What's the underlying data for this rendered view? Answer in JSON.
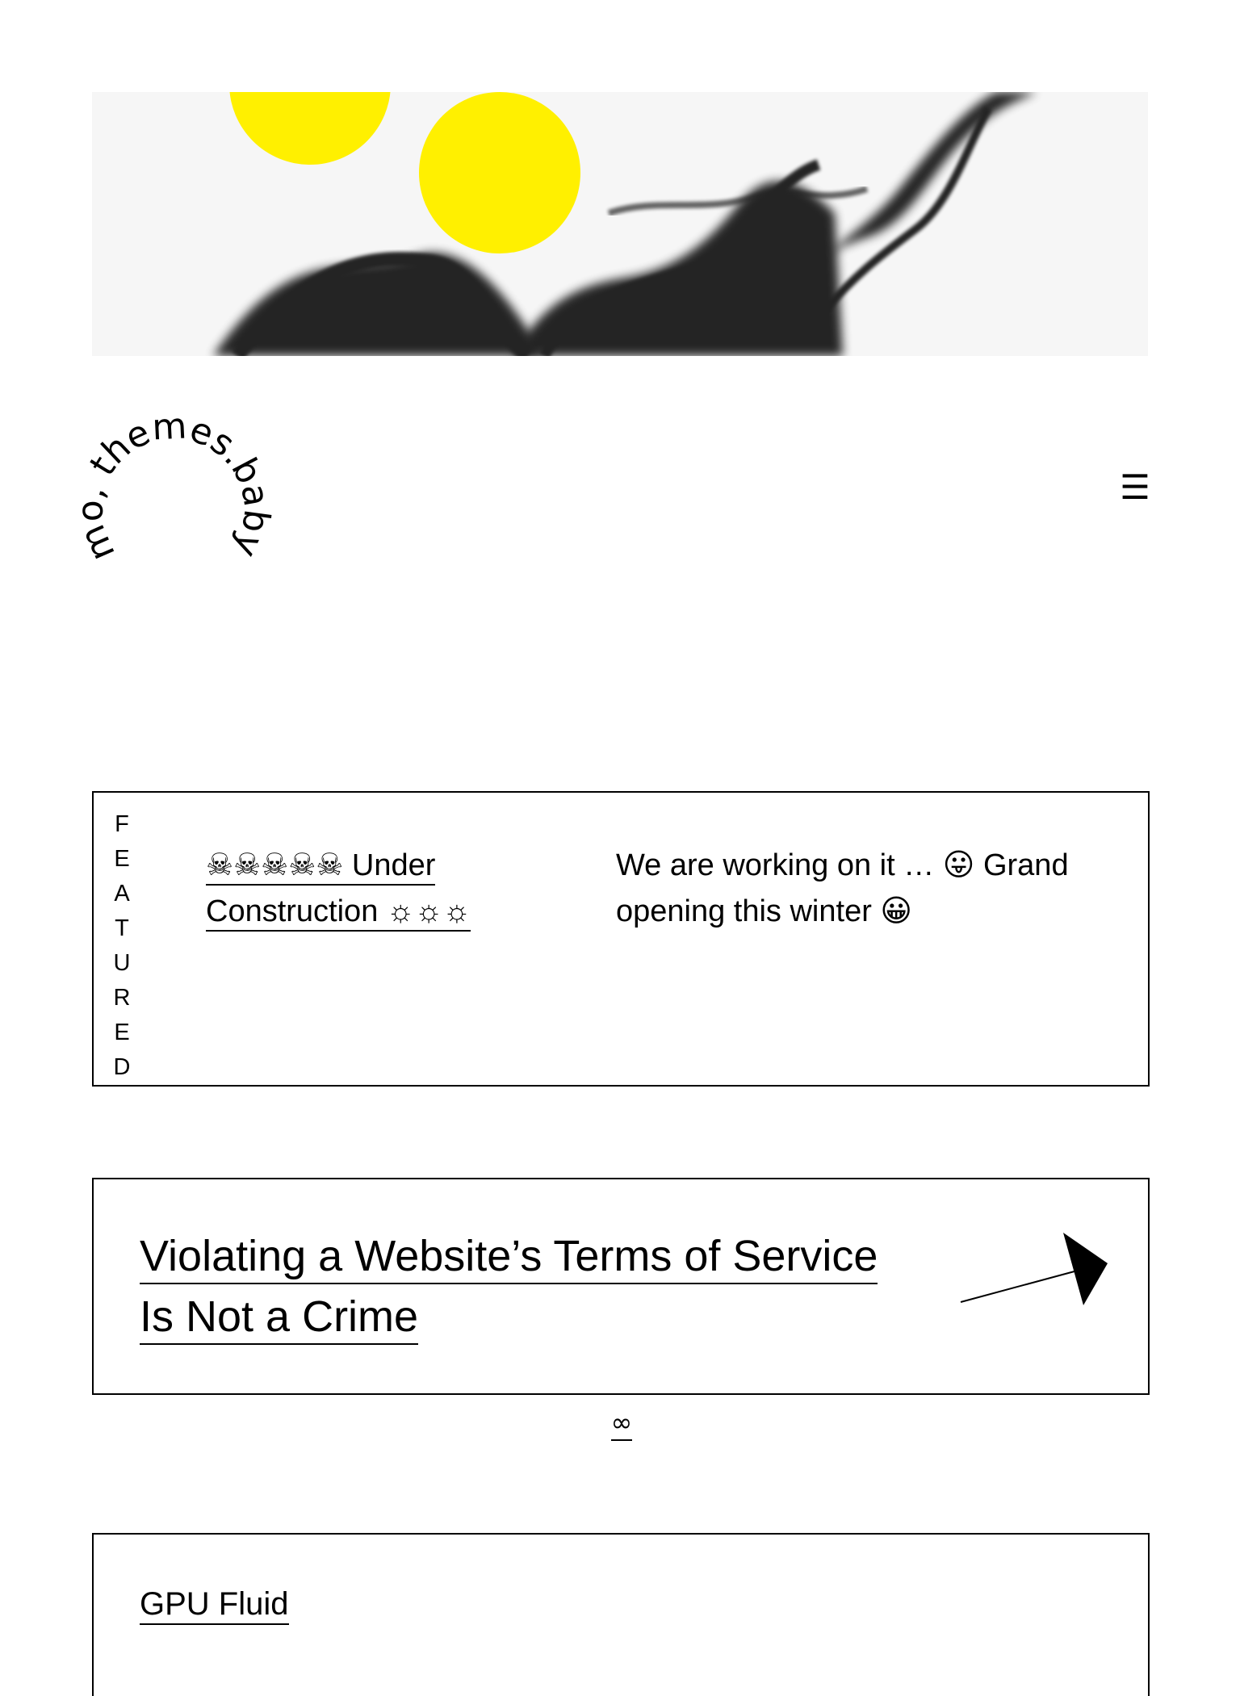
{
  "colors": {
    "accent": "#fff000",
    "ink": "#000000",
    "background": "#ffffff"
  },
  "header": {
    "logo_text": "mo, themes.baby",
    "menu_icon": "☰"
  },
  "featured": {
    "label_letters": [
      "F",
      "E",
      "A",
      "T",
      "U",
      "R",
      "E",
      "D"
    ],
    "title": "☠☠☠☠☠ Under Construction ☼☼☼",
    "excerpt": "We are working on it … 😛 Grand opening this winter 😀"
  },
  "posts": [
    {
      "title": "Violating a Website’s Terms of Service Is Not a Crime",
      "arrow_icon": "arrow-up-right-icon",
      "permalink": "∞"
    },
    {
      "title": "GPU Fluid"
    }
  ]
}
